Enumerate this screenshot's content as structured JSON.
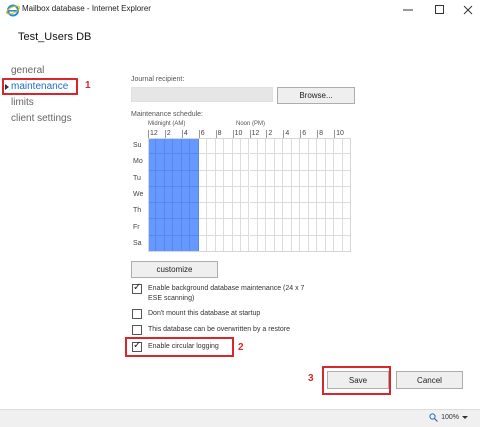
{
  "window": {
    "title": "Mailbox database - Internet Explorer"
  },
  "database_name": "Test_Users DB",
  "nav": {
    "items": [
      {
        "label": "general"
      },
      {
        "label": "maintenance"
      },
      {
        "label": "limits"
      },
      {
        "label": "client settings"
      }
    ],
    "active": "maintenance"
  },
  "journal": {
    "label": "Journal recipient:",
    "value": "",
    "browse_label": "Browse..."
  },
  "schedule": {
    "label": "Maintenance schedule:",
    "midnight_label": "Midnight (AM)",
    "noon_label": "Noon (PM)",
    "hours": [
      "12",
      "2",
      "4",
      "6",
      "8",
      "10",
      "12",
      "2",
      "4",
      "6",
      "8",
      "10"
    ],
    "days": [
      "Su",
      "Mo",
      "Tu",
      "We",
      "Th",
      "Fr",
      "Sa"
    ],
    "selected_hours": [
      0,
      1,
      2,
      3,
      4,
      5
    ],
    "selected_color": "#6699ff",
    "customize_label": "customize"
  },
  "options": [
    {
      "label": "Enable background database maintenance (24 x 7 ESE scanning)",
      "checked": true
    },
    {
      "label": "Don't mount this database at startup",
      "checked": false
    },
    {
      "label": "This database can be overwritten by a restore",
      "checked": false
    },
    {
      "label": "Enable circular logging",
      "checked": true
    }
  ],
  "buttons": {
    "save_label": "Save",
    "cancel_label": "Cancel"
  },
  "annotations": [
    "1",
    "2",
    "3"
  ],
  "annotation_color": "#d9262d",
  "status": {
    "zoom": "100%"
  }
}
